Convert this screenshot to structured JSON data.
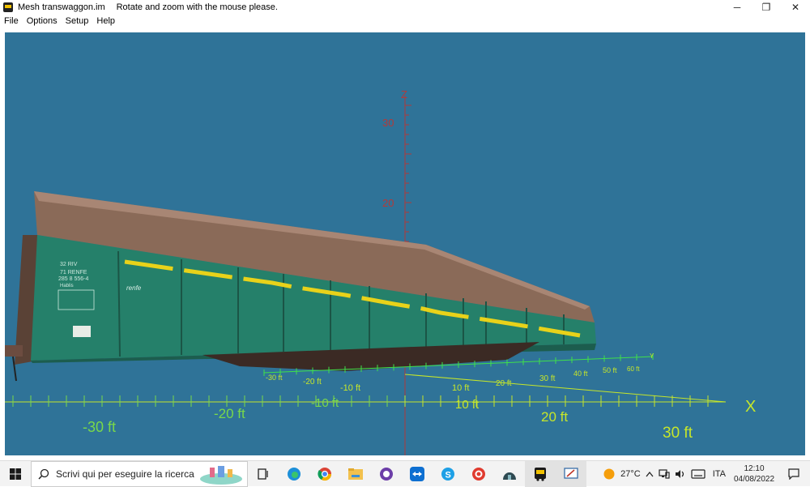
{
  "window": {
    "title": "Mesh transwaggon.im",
    "hint": "Rotate and zoom with the mouse please.",
    "controls": {
      "minimize": "─",
      "restore": "❐",
      "close": "✕"
    }
  },
  "menu": [
    "File",
    "Options",
    "Setup",
    "Help"
  ],
  "viewport": {
    "background": "#2f7398",
    "axis_z_label": "Z",
    "axis_x_label": "X",
    "axis_y_label": "Y",
    "z_ticks": [
      "30",
      "20"
    ],
    "x_ticks_front": [
      "-30 ft",
      "-20 ft",
      "-10 ft",
      "10 ft",
      "20 ft",
      "30 ft"
    ],
    "y_ticks": [
      "-30 ft",
      "-20 ft",
      "-10 ft",
      "10 ft",
      "20 ft",
      "30 ft",
      "40 ft",
      "50 ft",
      "60 ft"
    ],
    "colors": {
      "z_axis": "#b23a3a",
      "x_axis": "#c6e62a",
      "y_axis": "#3fe04a",
      "wagon_body": "#25806a",
      "wagon_roof": "#8a6a58",
      "stripe": "#e8d21a"
    },
    "wagon_markings": {
      "code_lines": [
        "32 RIV",
        "71 RENFE",
        "285 8 556-4",
        "Hablis"
      ],
      "brand": "renfe"
    }
  },
  "taskbar": {
    "search_placeholder": "Scrivi qui per eseguire la ricerca",
    "weather": "27°C",
    "language": "ITA",
    "time": "12:10",
    "date": "04/08/2022"
  }
}
